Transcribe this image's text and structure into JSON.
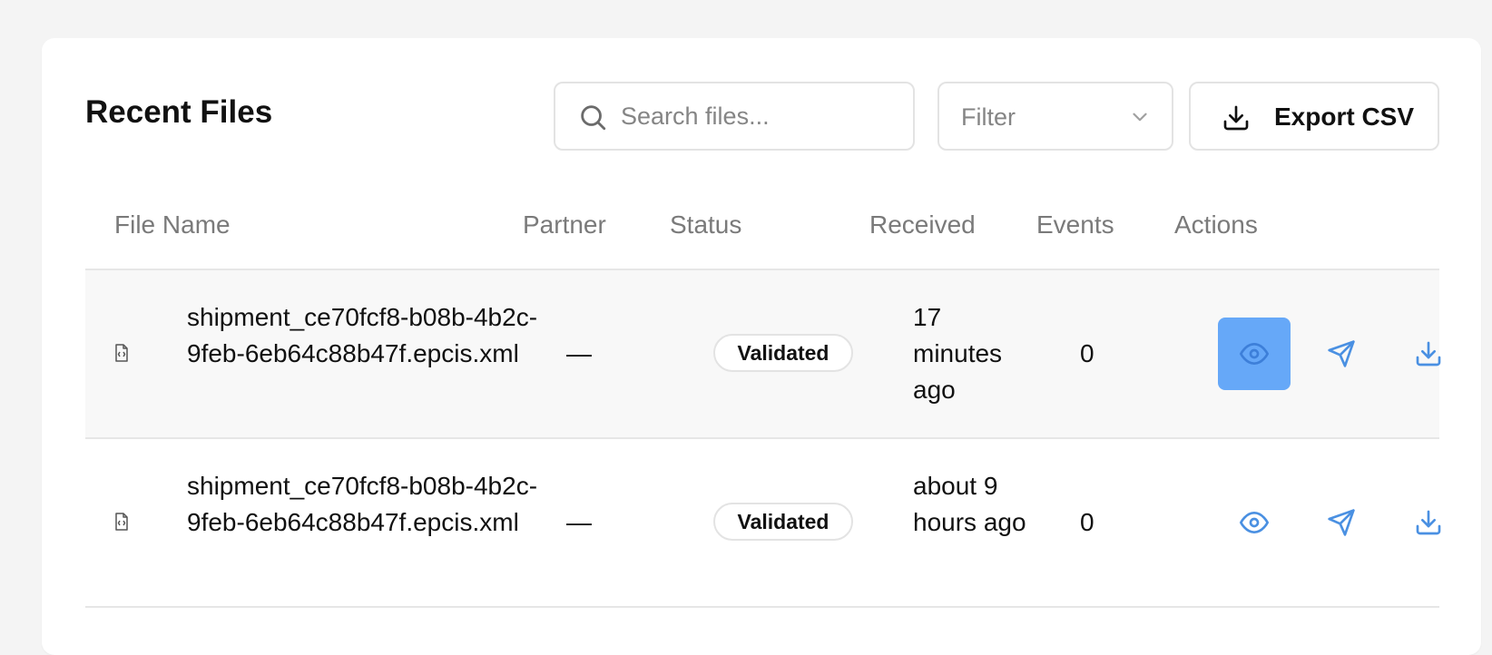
{
  "panel": {
    "title": "Recent Files",
    "search": {
      "placeholder": "Search files...",
      "value": ""
    },
    "filter": {
      "label": "Filter"
    },
    "export": {
      "label": "Export CSV"
    }
  },
  "table": {
    "columns": [
      "File Name",
      "Partner",
      "Status",
      "Received",
      "Events",
      "Actions"
    ],
    "rows": [
      {
        "file_name": "shipment_ce70fcf8-b08b-4b2c-9feb-6eb64c88b47f.epcis.xml",
        "partner": "—",
        "status": "Validated",
        "received": "17 minutes ago",
        "events": "0",
        "actions": [
          "eye-icon",
          "send-icon",
          "download-icon"
        ],
        "active_action": "view"
      },
      {
        "file_name": "shipment_ce70fcf8-b08b-4b2c-9feb-6eb64c88b47f.epcis.xml",
        "partner": "—",
        "status": "Validated",
        "received": "about 9 hours ago",
        "events": "0",
        "actions": [
          "eye-icon",
          "send-icon",
          "download-icon"
        ],
        "active_action": ""
      }
    ]
  },
  "colors": {
    "accent": "#4a90e2",
    "active_action_bg": "#66a8f8",
    "header_text": "#7a7a7a",
    "row_alt_bg": "#f8f8f8"
  }
}
